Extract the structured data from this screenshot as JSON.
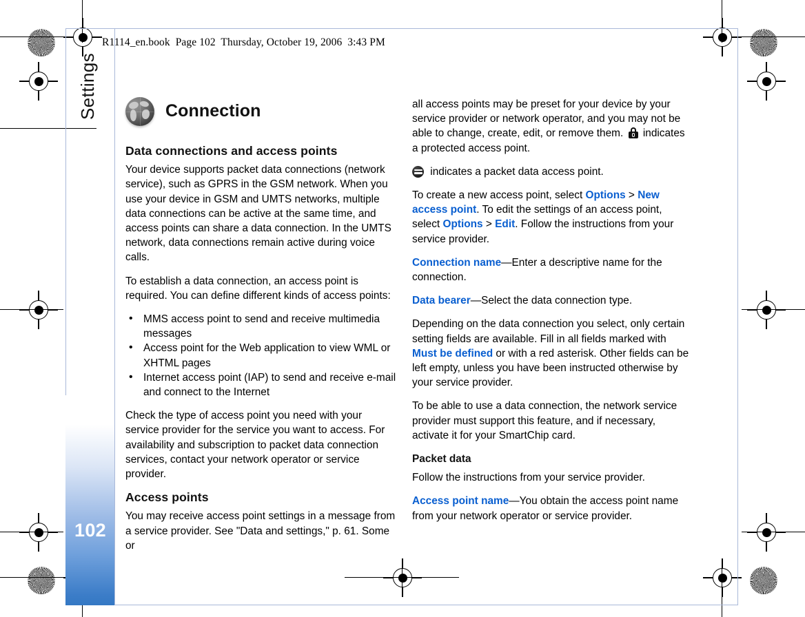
{
  "print_header": "R1114_en.book  Page 102  Thursday, October 19, 2006  3:43 PM",
  "page_number": "102",
  "chapter_label": "Settings",
  "accent_color": "#0a5fd0",
  "band_color": "#3478c4",
  "section": {
    "icon": "globe-icon",
    "title": "Connection"
  },
  "left_column": {
    "heading": "Data connections and access points",
    "paragraph_1": "Your device supports packet data connections (network service), such as GPRS in the GSM network. When you use your device in GSM and UMTS networks, multiple data connections can be active at the same time, and access points can share a data connection. In the UMTS network, data connections remain active during voice calls.",
    "paragraph_2": "To establish a data connection, an access point is required. You can define different kinds of access points:",
    "bullets": [
      "MMS access point to send and receive multimedia messages",
      "Access point for the Web application to view WML or XHTML pages",
      "Internet access point (IAP) to send and receive e-mail and connect to the Internet"
    ],
    "paragraph_3": "Check the type of access point you need with your service provider for the service you want to access. For availability and subscription to packet data connection services, contact your network operator or service provider.",
    "subheading": "Access points",
    "paragraph_4": "You may receive access point settings in a message from a service provider. See \"Data and settings,\" p. 61. Some or"
  },
  "right_column": {
    "paragraph_1_a": "all access points may be preset for your device by your service provider or network operator, and you may not be able to change, create, edit, or remove them. ",
    "paragraph_1_b": " indicates a protected access point.",
    "lock_icon": "padlock-icon",
    "packet_icon": "packet-data-icon",
    "paragraph_2": " indicates a packet data access point.",
    "create_line": {
      "text_1": "To create a new access point, select ",
      "term_1": "Options",
      "sep_1": " > ",
      "term_2": "New access point",
      "text_2": ". To edit the settings of an access point, select ",
      "term_3": "Options",
      "sep_2": " > ",
      "term_4": "Edit",
      "text_3": ". Follow the instructions from your service provider."
    },
    "connection_name": {
      "term": "Connection name",
      "text": "—Enter a descriptive name for the connection."
    },
    "data_bearer": {
      "term": "Data bearer",
      "text": "—Select the data connection type."
    },
    "depending_line": {
      "text_1": "Depending on the data connection you select, only certain setting fields are available. Fill in all fields marked with ",
      "term_1": "Must be defined",
      "text_2": " or with a red asterisk. Other fields can be left empty, unless you have been instructed otherwise by your service provider."
    },
    "paragraph_3": "To be able to use a data connection, the network service provider must support this feature, and if necessary, activate it for your SmartChip card.",
    "packet_data_heading": "Packet data",
    "paragraph_4": "Follow the instructions from your service provider.",
    "access_point_name": {
      "term": "Access point name",
      "text": "—You obtain the access point name from your network operator or service provider."
    }
  }
}
